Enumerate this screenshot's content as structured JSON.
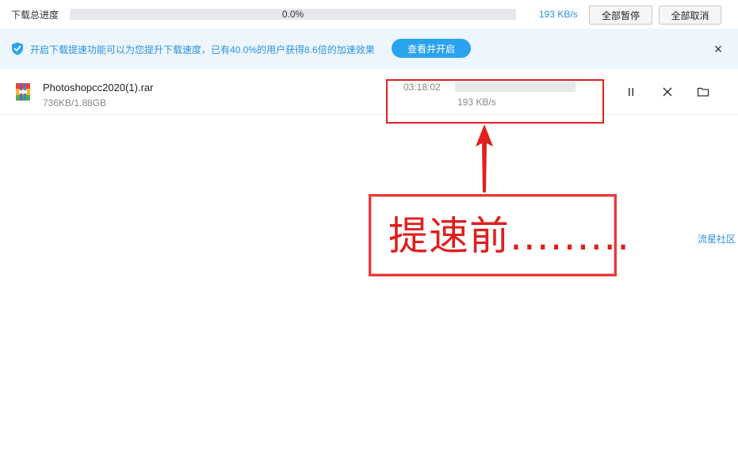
{
  "topbar": {
    "label": "下载总进度",
    "progress_percent": 0.0,
    "progress_text": "0.0%",
    "speed": "193 KB/s",
    "pause_all_label": "全部暂停",
    "cancel_all_label": "全部取消"
  },
  "banner": {
    "icon": "shield-check-icon",
    "message": "开启下载提速功能可以为您提升下载速度，已有40.0%的用户获得8.6倍的加速效果",
    "cta_label": "查看并开启",
    "close_icon": "close-icon"
  },
  "downloads": [
    {
      "file_icon": "winrar-archive-icon",
      "file_name": "Photoshopcc2020(1).rar",
      "size_text": "736KB/1.88GB",
      "remaining_time": "03:18:02",
      "progress_fraction": 0.0004,
      "speed": "193 KB/s",
      "actions": [
        "pause-icon",
        "close-icon",
        "folder-icon"
      ]
    }
  ],
  "annotation": {
    "callout_text": "提速前.........",
    "color": "#e02020"
  },
  "side_link": "流星社区",
  "colors": {
    "accent": "#2aa3ef",
    "banner_bg": "#eef6fd",
    "annotation_red": "#e02020"
  }
}
